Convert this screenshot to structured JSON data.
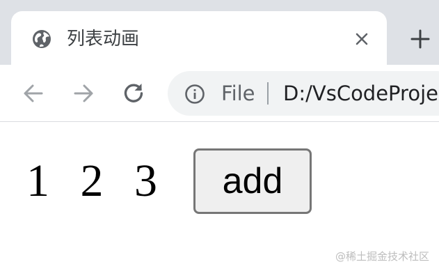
{
  "tab": {
    "title": "列表动画",
    "favicon_icon": "globe-icon",
    "close_icon": "close-icon"
  },
  "tabstrip": {
    "new_tab_icon": "plus-icon"
  },
  "toolbar": {
    "back_icon": "arrow-left-icon",
    "forward_icon": "arrow-right-icon",
    "reload_icon": "reload-icon"
  },
  "omnibox": {
    "info_icon": "info-icon",
    "scheme": "File",
    "url": "D:/VsCodeProje"
  },
  "page": {
    "list": [
      "1",
      "2",
      "3"
    ],
    "add_button_label": "add"
  },
  "watermark": {
    "text": "@稀土掘金技术社区"
  },
  "colors": {
    "tabstrip_bg": "#dee1e6",
    "omnibox_bg": "#f1f3f4",
    "icon_gray": "#5f6368",
    "disabled_gray": "#a0a4a8",
    "button_bg": "#efefef",
    "button_border": "#767676"
  }
}
